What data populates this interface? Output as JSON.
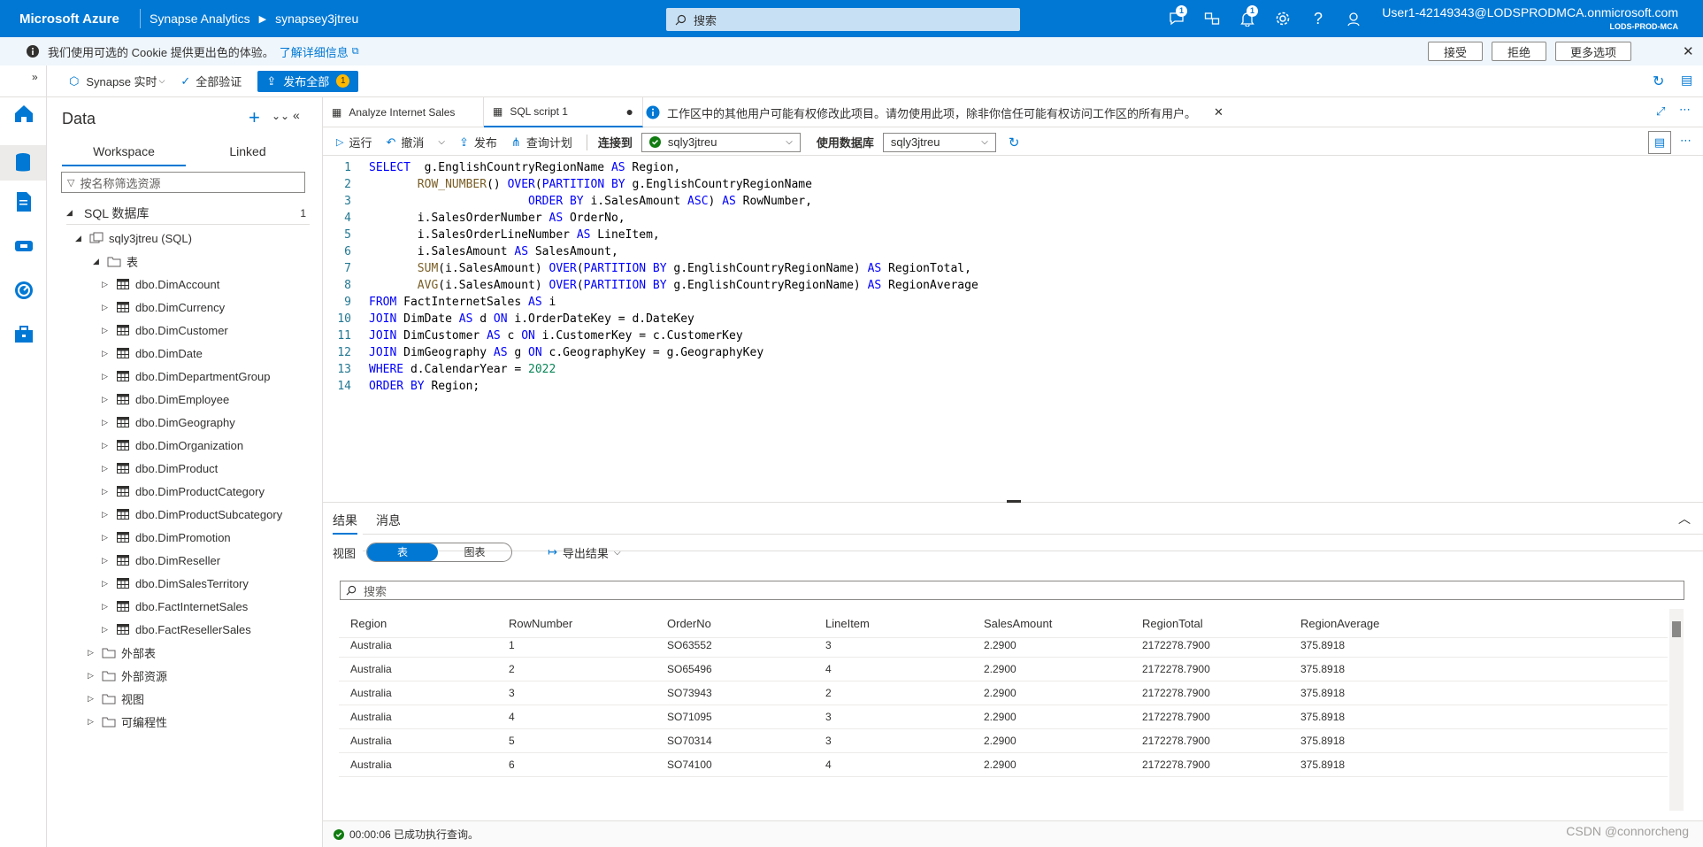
{
  "topbar": {
    "brand": "Microsoft Azure",
    "service": "Synapse Analytics",
    "workspace": "synapsey3jtreu",
    "search_placeholder": "搜索",
    "badges": {
      "feedback": "1",
      "notifications": "1"
    },
    "user": "User1-42149343@LODSPRODMCA.onmicrosoft.com",
    "tenant": "LODS-PROD-MCA"
  },
  "cookie": {
    "text": "我们使用可选的 Cookie 提供更出色的体验。",
    "link": "了解详细信息",
    "accept": "接受",
    "reject": "拒绝",
    "more": "更多选项"
  },
  "cmdbar": {
    "synapse_live": "Synapse 实时",
    "validate_all": "全部验证",
    "publish_all": "发布全部",
    "publish_count": "1"
  },
  "datapanel": {
    "title": "Data",
    "tab_workspace": "Workspace",
    "tab_linked": "Linked",
    "filter_placeholder": "按名称筛选资源",
    "sql_db": "SQL 数据库",
    "sql_db_count": "1",
    "database": "sqly3jtreu (SQL)",
    "tables_folder": "表",
    "tables": [
      "dbo.DimAccount",
      "dbo.DimCurrency",
      "dbo.DimCustomer",
      "dbo.DimDate",
      "dbo.DimDepartmentGroup",
      "dbo.DimEmployee",
      "dbo.DimGeography",
      "dbo.DimOrganization",
      "dbo.DimProduct",
      "dbo.DimProductCategory",
      "dbo.DimProductSubcategory",
      "dbo.DimPromotion",
      "dbo.DimReseller",
      "dbo.DimSalesTerritory",
      "dbo.FactInternetSales",
      "dbo.FactResellerSales"
    ],
    "folders": [
      "外部表",
      "外部资源",
      "视图",
      "可编程性"
    ]
  },
  "editor": {
    "tab1": "Analyze Internet Sales",
    "tab2": "SQL script 1",
    "info": "工作区中的其他用户可能有权修改此项目。请勿使用此项，除非你信任可能有权访问工作区的所有用户。",
    "run": "运行",
    "undo": "撤消",
    "publish": "发布",
    "query_plan": "查询计划",
    "connect_to": "连接到",
    "connection": "sqly3jtreu",
    "use_db": "使用数据库",
    "database": "sqly3jtreu"
  },
  "code_lines": [
    [
      {
        "t": "SELECT",
        "c": "kw"
      },
      {
        "t": "  g.EnglishCountryRegionName ",
        "c": "tx"
      },
      {
        "t": "AS",
        "c": "kw"
      },
      {
        "t": " Region,",
        "c": "tx"
      }
    ],
    [
      {
        "t": "       ",
        "c": "tx"
      },
      {
        "t": "ROW_NUMBER",
        "c": "fn"
      },
      {
        "t": "() ",
        "c": "tx"
      },
      {
        "t": "OVER",
        "c": "kw"
      },
      {
        "t": "(",
        "c": "tx"
      },
      {
        "t": "PARTITION BY",
        "c": "kw"
      },
      {
        "t": " g.EnglishCountryRegionName",
        "c": "tx"
      }
    ],
    [
      {
        "t": "                       ",
        "c": "tx"
      },
      {
        "t": "ORDER BY",
        "c": "kw"
      },
      {
        "t": " i.SalesAmount ",
        "c": "tx"
      },
      {
        "t": "ASC",
        "c": "kw"
      },
      {
        "t": ") ",
        "c": "tx"
      },
      {
        "t": "AS",
        "c": "kw"
      },
      {
        "t": " RowNumber,",
        "c": "tx"
      }
    ],
    [
      {
        "t": "       i.SalesOrderNumber ",
        "c": "tx"
      },
      {
        "t": "AS",
        "c": "kw"
      },
      {
        "t": " OrderNo,",
        "c": "tx"
      }
    ],
    [
      {
        "t": "       i.SalesOrderLineNumber ",
        "c": "tx"
      },
      {
        "t": "AS",
        "c": "kw"
      },
      {
        "t": " LineItem,",
        "c": "tx"
      }
    ],
    [
      {
        "t": "       i.SalesAmount ",
        "c": "tx"
      },
      {
        "t": "AS",
        "c": "kw"
      },
      {
        "t": " SalesAmount,",
        "c": "tx"
      }
    ],
    [
      {
        "t": "       ",
        "c": "tx"
      },
      {
        "t": "SUM",
        "c": "fn"
      },
      {
        "t": "(i.SalesAmount) ",
        "c": "tx"
      },
      {
        "t": "OVER",
        "c": "kw"
      },
      {
        "t": "(",
        "c": "tx"
      },
      {
        "t": "PARTITION BY",
        "c": "kw"
      },
      {
        "t": " g.EnglishCountryRegionName) ",
        "c": "tx"
      },
      {
        "t": "AS",
        "c": "kw"
      },
      {
        "t": " RegionTotal,",
        "c": "tx"
      }
    ],
    [
      {
        "t": "       ",
        "c": "tx"
      },
      {
        "t": "AVG",
        "c": "fn"
      },
      {
        "t": "(i.SalesAmount) ",
        "c": "tx"
      },
      {
        "t": "OVER",
        "c": "kw"
      },
      {
        "t": "(",
        "c": "tx"
      },
      {
        "t": "PARTITION BY",
        "c": "kw"
      },
      {
        "t": " g.EnglishCountryRegionName) ",
        "c": "tx"
      },
      {
        "t": "AS",
        "c": "kw"
      },
      {
        "t": " RegionAverage",
        "c": "tx"
      }
    ],
    [
      {
        "t": "FROM",
        "c": "kw"
      },
      {
        "t": " FactInternetSales ",
        "c": "tx"
      },
      {
        "t": "AS",
        "c": "kw"
      },
      {
        "t": " i",
        "c": "tx"
      }
    ],
    [
      {
        "t": "JOIN",
        "c": "kw"
      },
      {
        "t": " DimDate ",
        "c": "tx"
      },
      {
        "t": "AS",
        "c": "kw"
      },
      {
        "t": " d ",
        "c": "tx"
      },
      {
        "t": "ON",
        "c": "kw"
      },
      {
        "t": " i.OrderDateKey = d.DateKey",
        "c": "tx"
      }
    ],
    [
      {
        "t": "JOIN",
        "c": "kw"
      },
      {
        "t": " DimCustomer ",
        "c": "tx"
      },
      {
        "t": "AS",
        "c": "kw"
      },
      {
        "t": " c ",
        "c": "tx"
      },
      {
        "t": "ON",
        "c": "kw"
      },
      {
        "t": " i.CustomerKey = c.CustomerKey",
        "c": "tx"
      }
    ],
    [
      {
        "t": "JOIN",
        "c": "kw"
      },
      {
        "t": " DimGeography ",
        "c": "tx"
      },
      {
        "t": "AS",
        "c": "kw"
      },
      {
        "t": " g ",
        "c": "tx"
      },
      {
        "t": "ON",
        "c": "kw"
      },
      {
        "t": " c.GeographyKey = g.GeographyKey",
        "c": "tx"
      }
    ],
    [
      {
        "t": "WHERE",
        "c": "kw"
      },
      {
        "t": " d.CalendarYear = ",
        "c": "tx"
      },
      {
        "t": "2022",
        "c": "num"
      }
    ],
    [
      {
        "t": "ORDER BY",
        "c": "kw"
      },
      {
        "t": " Region;",
        "c": "tx"
      }
    ]
  ],
  "results": {
    "tab_results": "结果",
    "tab_messages": "消息",
    "view_label": "视图",
    "view_table": "表",
    "view_chart": "图表",
    "export": "导出结果",
    "search_placeholder": "搜索",
    "columns": [
      "Region",
      "RowNumber",
      "OrderNo",
      "LineItem",
      "SalesAmount",
      "RegionTotal",
      "RegionAverage"
    ],
    "rows": [
      [
        "Australia",
        "1",
        "SO63552",
        "3",
        "2.2900",
        "2172278.7900",
        "375.8918"
      ],
      [
        "Australia",
        "2",
        "SO65496",
        "4",
        "2.2900",
        "2172278.7900",
        "375.8918"
      ],
      [
        "Australia",
        "3",
        "SO73943",
        "2",
        "2.2900",
        "2172278.7900",
        "375.8918"
      ],
      [
        "Australia",
        "4",
        "SO71095",
        "3",
        "2.2900",
        "2172278.7900",
        "375.8918"
      ],
      [
        "Australia",
        "5",
        "SO70314",
        "3",
        "2.2900",
        "2172278.7900",
        "375.8918"
      ],
      [
        "Australia",
        "6",
        "SO74100",
        "4",
        "2.2900",
        "2172278.7900",
        "375.8918"
      ]
    ]
  },
  "status": {
    "text": "00:00:06 已成功执行查询。"
  },
  "watermark": "CSDN @connorcheng",
  "colors": {
    "accent": "#0078d4",
    "keyword": "#0000ff",
    "function": "#795e26",
    "number": "#098658",
    "success": "#107c10"
  }
}
